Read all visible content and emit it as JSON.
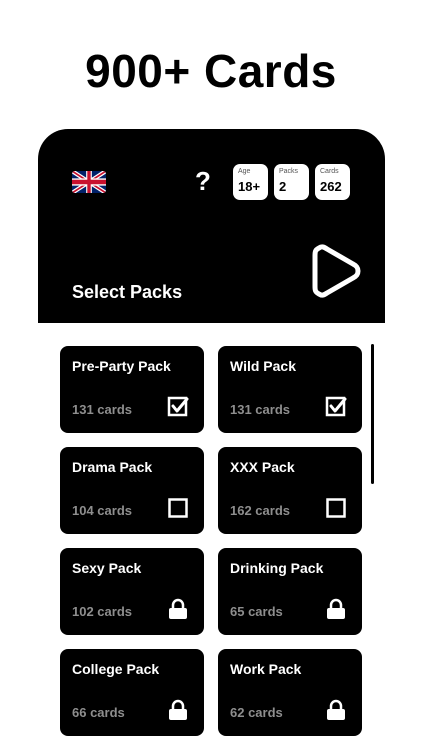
{
  "headline": "900+ Cards",
  "header": {
    "flag_icon": "uk-flag-icon",
    "help_label": "?",
    "stats": {
      "age": {
        "label": "Age",
        "value": "18+"
      },
      "packs": {
        "label": "Packs",
        "value": "2"
      },
      "cards": {
        "label": "Cards",
        "value": "262"
      }
    },
    "play_icon": "play-icon",
    "title": "Select Packs"
  },
  "packs": [
    {
      "name": "Pre-Party Pack",
      "count": "131 cards",
      "state": "checked"
    },
    {
      "name": "Wild Pack",
      "count": "131 cards",
      "state": "checked"
    },
    {
      "name": "Drama Pack",
      "count": "104 cards",
      "state": "unchecked"
    },
    {
      "name": "XXX Pack",
      "count": "162 cards",
      "state": "unchecked"
    },
    {
      "name": "Sexy Pack",
      "count": "102 cards",
      "state": "locked"
    },
    {
      "name": "Drinking Pack",
      "count": "65 cards",
      "state": "locked"
    },
    {
      "name": "College Pack",
      "count": "66 cards",
      "state": "locked"
    },
    {
      "name": "Work Pack",
      "count": "62 cards",
      "state": "locked"
    }
  ],
  "colors": {
    "background": "#000000",
    "muted_text": "#8e8e8e"
  }
}
